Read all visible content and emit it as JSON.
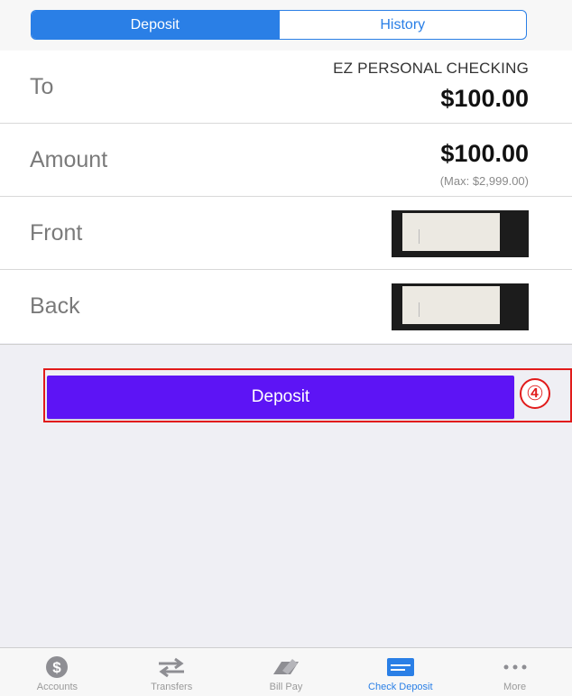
{
  "segment": {
    "deposit_label": "Deposit",
    "history_label": "History"
  },
  "rows": {
    "to_label": "To",
    "to_account": "EZ PERSONAL CHECKING",
    "to_balance": "$100.00",
    "amount_label": "Amount",
    "amount_value": "$100.00",
    "amount_max": "(Max: $2,999.00)",
    "front_label": "Front",
    "back_label": "Back"
  },
  "deposit_button_label": "Deposit",
  "annotation_step": "④",
  "tabs": [
    {
      "label": "Accounts",
      "icon": "dollar-circle-icon"
    },
    {
      "label": "Transfers",
      "icon": "transfer-arrows-icon"
    },
    {
      "label": "Bill Pay",
      "icon": "bill-pay-icon"
    },
    {
      "label": "Check Deposit",
      "icon": "check-deposit-icon",
      "active": true
    },
    {
      "label": "More",
      "icon": "more-icon"
    }
  ],
  "colors": {
    "accent_blue": "#2a7fe6",
    "deposit_button": "#5d14f5",
    "annotation_red": "#e11b1b"
  }
}
